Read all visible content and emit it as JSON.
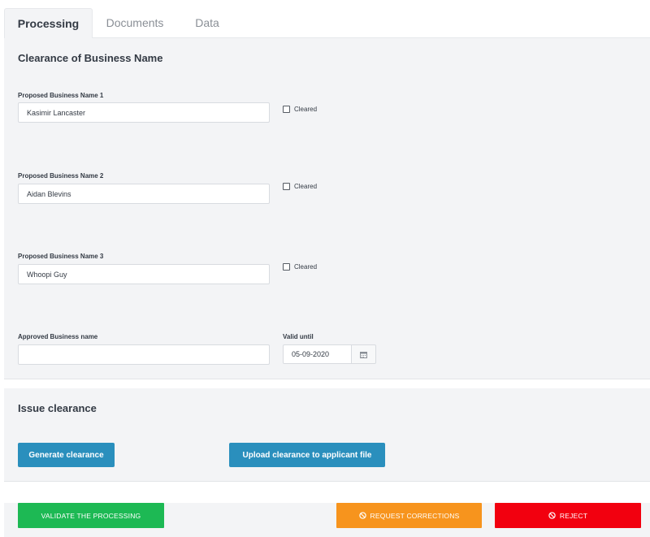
{
  "tabs": [
    {
      "label": "Processing",
      "active": true
    },
    {
      "label": "Documents",
      "active": false
    },
    {
      "label": "Data",
      "active": false
    }
  ],
  "clearance_section": {
    "title": "Clearance of Business Name",
    "names": [
      {
        "label": "Proposed Business Name 1",
        "value": "Kasimir Lancaster",
        "cleared_label": "Cleared",
        "cleared": false
      },
      {
        "label": "Proposed Business Name 2",
        "value": "Aidan Blevins",
        "cleared_label": "Cleared",
        "cleared": false
      },
      {
        "label": "Proposed Business Name 3",
        "value": "Whoopi Guy",
        "cleared_label": "Cleared",
        "cleared": false
      }
    ],
    "approved": {
      "label": "Approved Business name",
      "value": ""
    },
    "valid_until": {
      "label": "Valid until",
      "value": "05-09-2020"
    }
  },
  "issue_section": {
    "title": "Issue clearance",
    "generate_label": "Generate clearance",
    "upload_label": "Upload clearance to applicant file"
  },
  "actions": {
    "validate_label": "VALIDATE THE PROCESSING",
    "request_label": "REQUEST CORRECTIONS",
    "reject_label": "REJECT"
  },
  "colors": {
    "validate": "#1db954",
    "request": "#f7941d",
    "reject": "#f2000f",
    "primary": "#2a8fbd",
    "panel_bg": "#f3f4f6"
  },
  "icons": {
    "calendar": "calendar-icon",
    "ban": "ban-icon"
  }
}
